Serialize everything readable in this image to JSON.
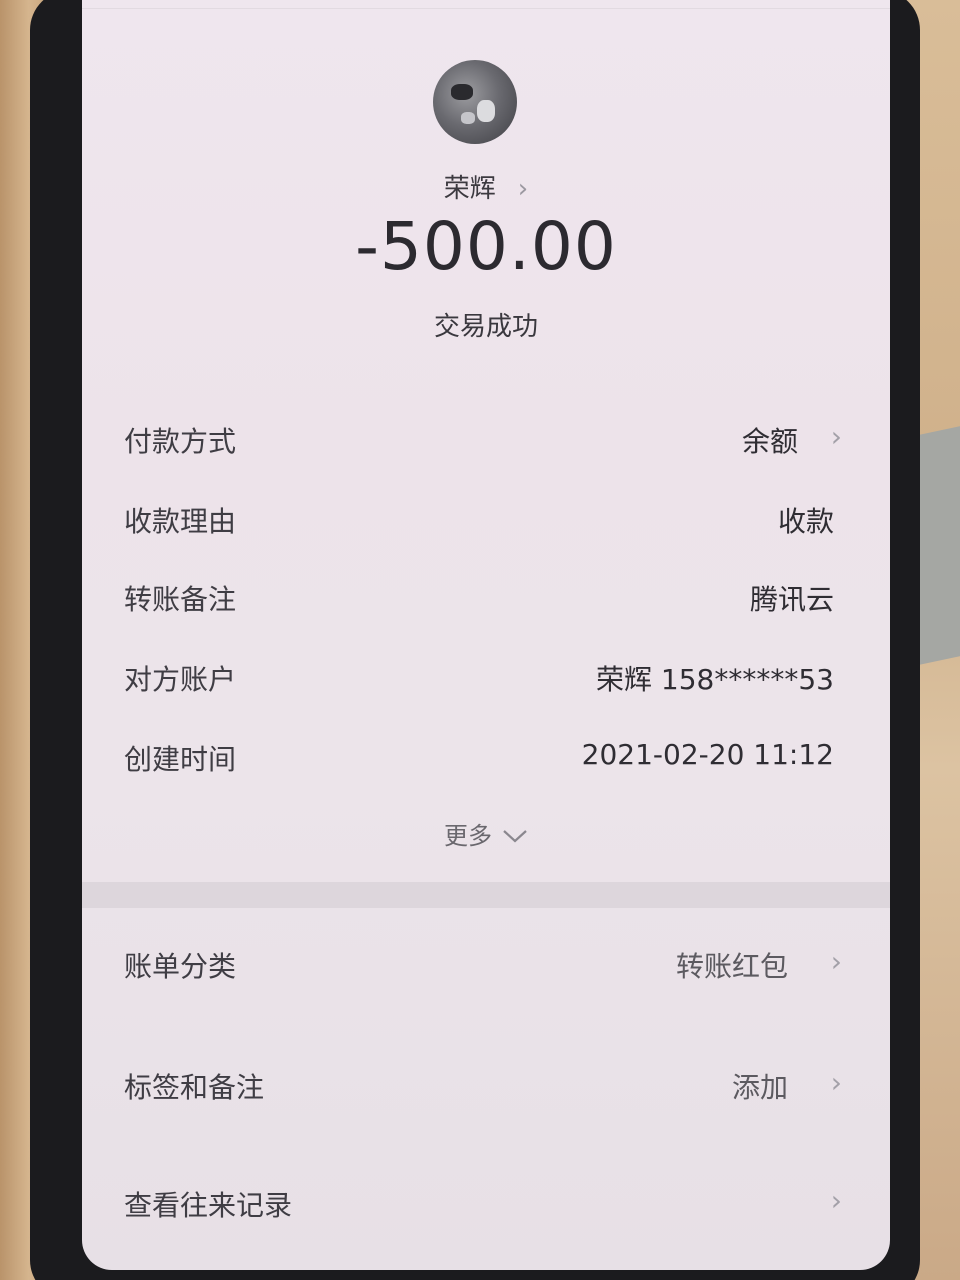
{
  "payee": {
    "name": "荣辉",
    "chevron": "›"
  },
  "amount": "-500.00",
  "status": "交易成功",
  "details": [
    {
      "label": "付款方式",
      "value": "余额",
      "chevron": "›"
    },
    {
      "label": "收款理由",
      "value": "收款"
    },
    {
      "label": "转账备注",
      "value": "腾讯云"
    },
    {
      "label": "对方账户",
      "value": "荣辉 158******53"
    },
    {
      "label": "创建时间",
      "value": "2021-02-20 11:12"
    }
  ],
  "more": {
    "label": "更多",
    "icon": "chevron-down-icon"
  },
  "actions": [
    {
      "label": "账单分类",
      "value": "转账红包",
      "chevron": "›"
    },
    {
      "label": "标签和备注",
      "value": "添加",
      "chevron": "›"
    },
    {
      "label": "查看往来记录",
      "value": "",
      "chevron": "›"
    }
  ]
}
